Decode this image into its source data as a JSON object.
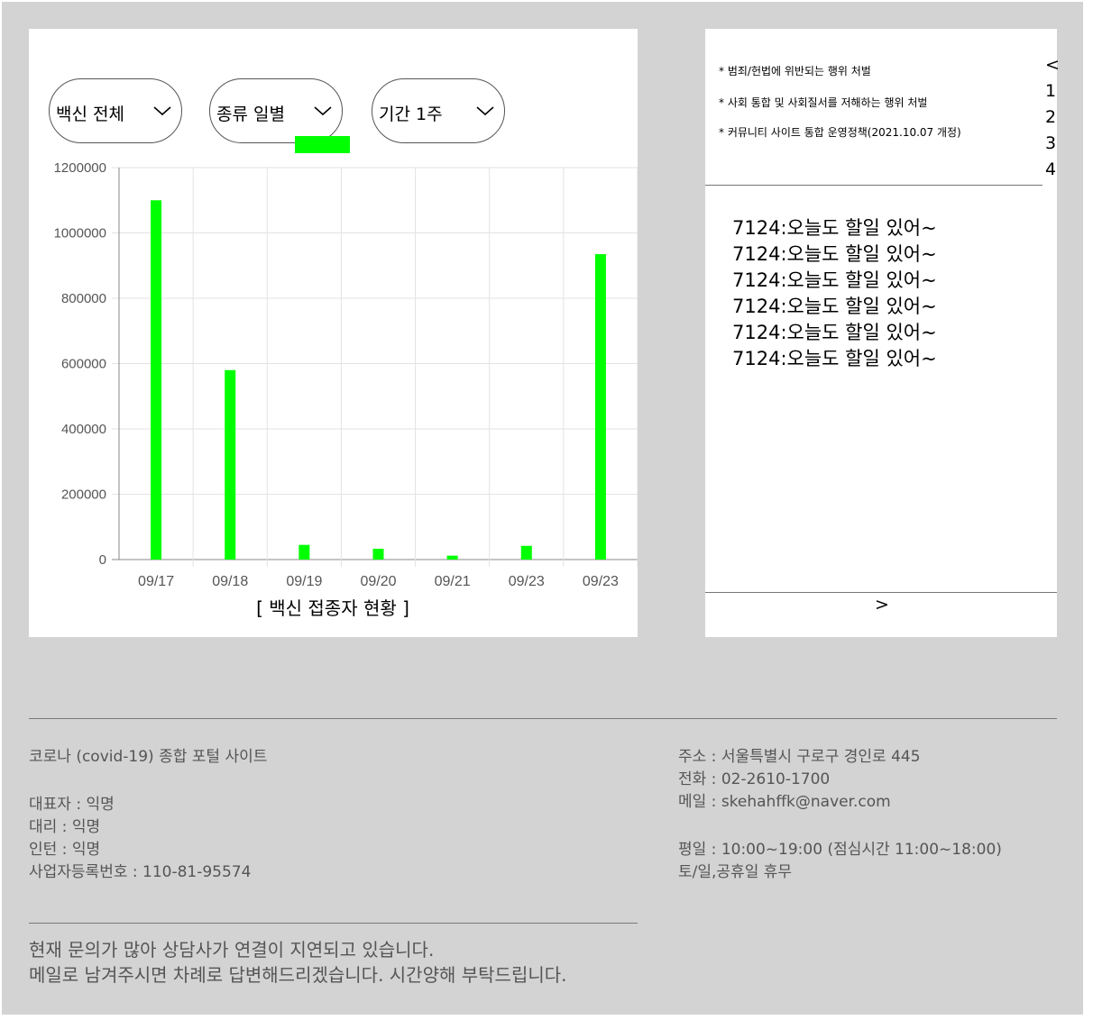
{
  "filters": {
    "vaccine": "백신 전체",
    "kind": "종류 일별",
    "period": "기간 1주"
  },
  "chart_data": {
    "type": "bar",
    "categories": [
      "09/17",
      "09/18",
      "09/19",
      "09/20",
      "09/21",
      "09/23",
      "09/23"
    ],
    "values": [
      1100000,
      580000,
      45000,
      33000,
      12000,
      42000,
      935000
    ],
    "title": "",
    "xlabel": "[ 백신 접종자 현황 ]",
    "ylabel": "",
    "ylim": [
      0,
      1200000
    ],
    "yticks": [
      "0",
      "200000",
      "400000",
      "600000",
      "800000",
      "1000000",
      "1200000"
    ],
    "bar_color": "#00ff00",
    "grid": true,
    "legend": "top"
  },
  "side": {
    "rules": [
      "* 범죄/헌법에 위반되는 행위 처벌",
      "* 사회 통합 및 사회질서를 저해하는 행위 처벌",
      "* 커뮤니티 사이트 통합 운영정책(2021.10.07 개정)"
    ],
    "pager": [
      "<",
      "1",
      "2",
      "3",
      "4"
    ],
    "messages": [
      "7124:오늘도 할일 있어~",
      "7124:오늘도 할일 있어~",
      "7124:오늘도 할일 있어~",
      "7124:오늘도 할일 있어~",
      "7124:오늘도 할일 있어~",
      "7124:오늘도 할일 있어~"
    ],
    "next": ">"
  },
  "footer": {
    "site_name": "코로나 (covid-19) 종합 포털 사이트",
    "ceo": "대표자 : 익명",
    "manager": "대리 : 익명",
    "intern": "인턴 : 익명",
    "biz_no": "사업자등록번호 : 110-81-95574",
    "address": "주소 : 서울특별시 구로구 경인로 445",
    "phone": "전화 : 02-2610-1700",
    "email": "메일 : skehahffk@naver.com",
    "hours_weekday": "평일 : 10:00~19:00 (점심시간 11:00~18:00)",
    "hours_weekend": "토/일,공휴일 휴무",
    "notice_1": "현재 문의가 많아 상담사가 연결이 지연되고 있습니다.",
    "notice_2": "메일로 남겨주시면 차례로 답변해드리겠습니다. 시간양해 부탁드립니다."
  }
}
